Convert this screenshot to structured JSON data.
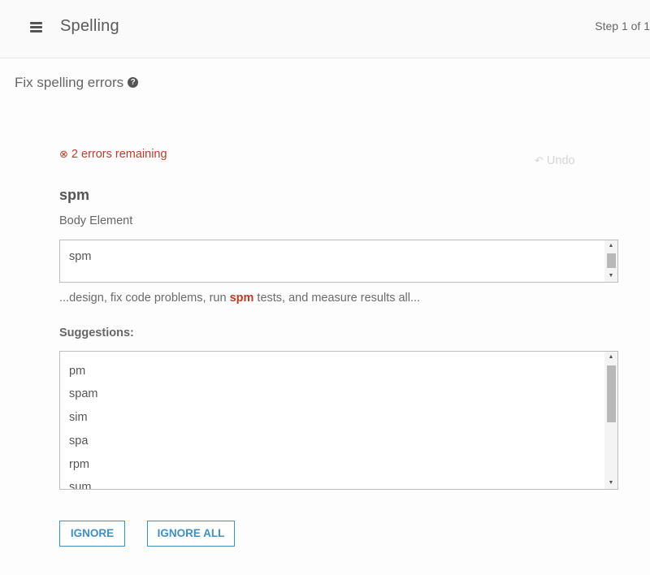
{
  "header": {
    "title": "Spelling",
    "step": "Step 1 of 1"
  },
  "section": {
    "title": "Fix spelling errors"
  },
  "status": {
    "errors_remaining": "2 errors remaining",
    "undo_label": "Undo"
  },
  "current": {
    "word": "spm",
    "element_label": "Body Element",
    "field_value": "spm",
    "context_before": "...design, fix code problems, run ",
    "context_word": "spm",
    "context_after": " tests, and measure results all..."
  },
  "suggestions": {
    "label": "Suggestions:",
    "items": [
      "pm",
      "spam",
      "sim",
      "spa",
      "rpm",
      "sum"
    ]
  },
  "buttons": {
    "ignore": "IGNORE",
    "ignore_all": "IGNORE ALL"
  },
  "colors": {
    "error": "#c0392b",
    "accent": "#3e8fc4",
    "disabled": "#d4d4d4"
  }
}
